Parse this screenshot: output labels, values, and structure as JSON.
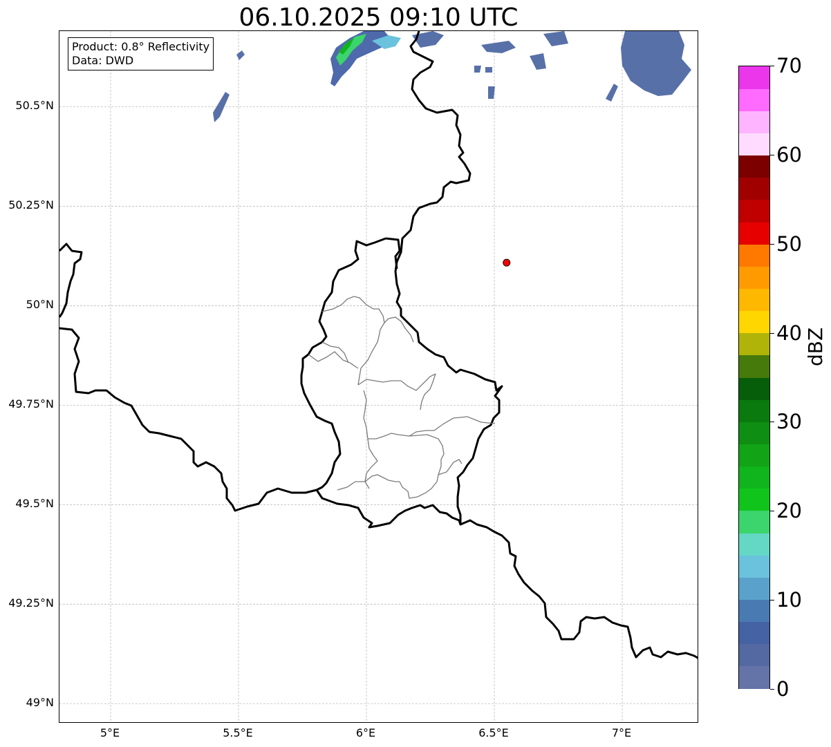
{
  "title": "06.10.2025 09:10 UTC",
  "info": {
    "product": "Product: 0.8° Reflectivity",
    "data": "Data: DWD"
  },
  "map": {
    "lon_range": [
      4.8,
      7.3
    ],
    "lat_range": [
      48.95,
      50.69
    ],
    "x_ticks": [
      {
        "value": 5.0,
        "label": "5°E"
      },
      {
        "value": 5.5,
        "label": "5.5°E"
      },
      {
        "value": 6.0,
        "label": "6°E"
      },
      {
        "value": 6.5,
        "label": "6.5°E"
      },
      {
        "value": 7.0,
        "label": "7°E"
      }
    ],
    "y_ticks": [
      {
        "value": 49.0,
        "label": "49°N"
      },
      {
        "value": 49.25,
        "label": "49.25°N"
      },
      {
        "value": 49.5,
        "label": "49.5°N"
      },
      {
        "value": 49.75,
        "label": "49.75°N"
      },
      {
        "value": 50.0,
        "label": "50°N"
      },
      {
        "value": 50.25,
        "label": "50.25°N"
      },
      {
        "value": 50.5,
        "label": "50.5°N"
      }
    ],
    "grid": "dashed",
    "marker": {
      "lon": 6.548,
      "lat": 50.108,
      "color": "#ff0000"
    }
  },
  "colorbar": {
    "unit": "dBZ",
    "min": 0,
    "max": 70,
    "tick_labels": [
      {
        "value": 0,
        "label": "0"
      },
      {
        "value": 10,
        "label": "10"
      },
      {
        "value": 20,
        "label": "20"
      },
      {
        "value": 30,
        "label": "30"
      },
      {
        "value": 40,
        "label": "40"
      },
      {
        "value": 50,
        "label": "50"
      },
      {
        "value": 60,
        "label": "60"
      },
      {
        "value": 70,
        "label": "70"
      }
    ],
    "colors": [
      "#6474a8",
      "#5468a2",
      "#4462a4",
      "#4a7ab2",
      "#5aa2cc",
      "#6ac2dc",
      "#64d8c4",
      "#3cd46c",
      "#10c41c",
      "#10b41c",
      "#12a416",
      "#0e8e12",
      "#0a7a0e",
      "#065e0a",
      "#467a0a",
      "#b0b408",
      "#ffd600",
      "#ffb800",
      "#ff9a00",
      "#ff7800",
      "#e60000",
      "#c00000",
      "#a00000",
      "#7c0000",
      "#ffdcff",
      "#ffb4ff",
      "#ff6aff",
      "#ec36ec"
    ]
  }
}
